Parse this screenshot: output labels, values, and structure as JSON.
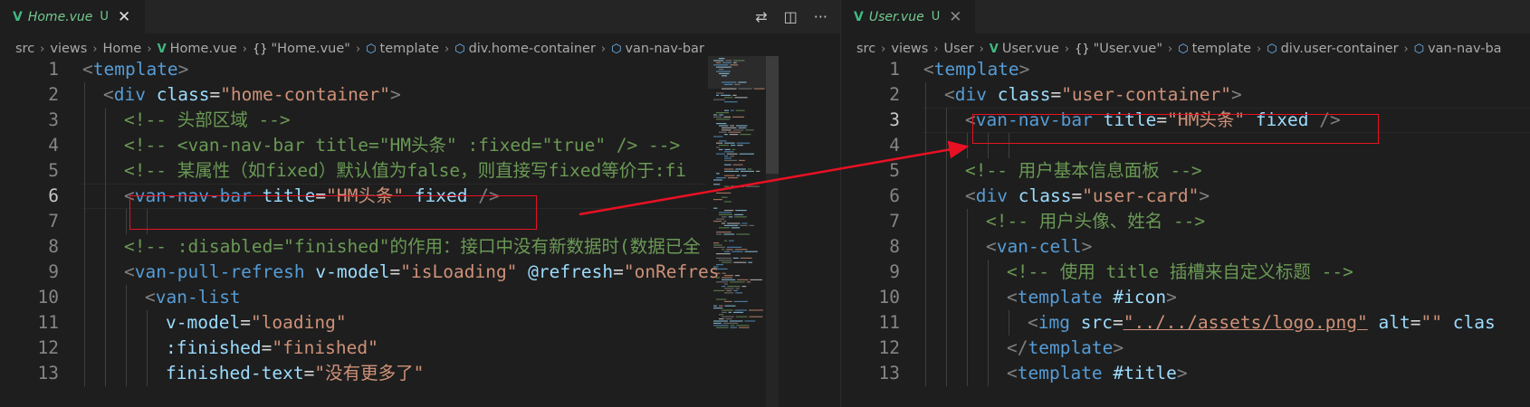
{
  "left": {
    "tab": {
      "icon": "vue-file-icon",
      "vicon": "V",
      "title": "Home.vue",
      "badge": "U",
      "close": "✕"
    },
    "actions": [
      {
        "name": "compare-changes-icon",
        "glyph": "⇄"
      },
      {
        "name": "split-editor-icon",
        "glyph": "◫"
      },
      {
        "name": "more-actions-icon",
        "glyph": "···"
      }
    ],
    "breadcrumb": [
      {
        "label": "src",
        "icon": ""
      },
      {
        "label": "views",
        "icon": ""
      },
      {
        "label": "Home",
        "icon": ""
      },
      {
        "label": "Home.vue",
        "icon": "vue-icon"
      },
      {
        "label": "\"Home.vue\"",
        "icon": "braces-icon"
      },
      {
        "label": "template",
        "icon": "cube-icon"
      },
      {
        "label": "div.home-container",
        "icon": "cube-icon"
      },
      {
        "label": "van-nav-bar",
        "icon": "cube-icon"
      }
    ],
    "current_line": 6,
    "lines": [
      {
        "n": "1",
        "indent": 0,
        "tokens": [
          [
            "punc",
            "<"
          ],
          [
            "tag",
            "template"
          ],
          [
            "punc",
            ">"
          ]
        ]
      },
      {
        "n": "2",
        "indent": 1,
        "tokens": [
          [
            "punc",
            "<"
          ],
          [
            "tag",
            "div"
          ],
          [
            "text",
            " "
          ],
          [
            "attr",
            "class"
          ],
          [
            "text",
            "="
          ],
          [
            "str",
            "\"home-container\""
          ],
          [
            "punc",
            ">"
          ]
        ]
      },
      {
        "n": "3",
        "indent": 2,
        "tokens": [
          [
            "com",
            "<!-- 头部区域 -->"
          ]
        ]
      },
      {
        "n": "4",
        "indent": 2,
        "tokens": [
          [
            "com",
            "<!-- <van-nav-bar title=\"HM头条\" :fixed=\"true\" /> -->"
          ]
        ]
      },
      {
        "n": "5",
        "indent": 2,
        "tokens": [
          [
            "com",
            "<!-- 某属性（如fixed）默认值为false，则直接写fixed等价于:fi"
          ]
        ]
      },
      {
        "n": "6",
        "indent": 2,
        "tokens": [
          [
            "punc",
            "<"
          ],
          [
            "tag",
            "van-nav-bar"
          ],
          [
            "text",
            " "
          ],
          [
            "attr",
            "title"
          ],
          [
            "text",
            "="
          ],
          [
            "str",
            "\"HM头条\""
          ],
          [
            "text",
            " "
          ],
          [
            "attr",
            "fixed"
          ],
          [
            "text",
            " "
          ],
          [
            "punc",
            "/>"
          ]
        ]
      },
      {
        "n": "7",
        "indent": 2,
        "tokens": []
      },
      {
        "n": "8",
        "indent": 2,
        "tokens": [
          [
            "com",
            "<!-- :disabled=\"finished\"的作用：接口中没有新数据时(数据已全"
          ]
        ]
      },
      {
        "n": "9",
        "indent": 2,
        "tokens": [
          [
            "punc",
            "<"
          ],
          [
            "tag",
            "van-pull-refresh"
          ],
          [
            "text",
            " "
          ],
          [
            "attr",
            "v-model"
          ],
          [
            "text",
            "="
          ],
          [
            "str",
            "\"isLoading\""
          ],
          [
            "text",
            " "
          ],
          [
            "attr",
            "@refresh"
          ],
          [
            "text",
            "="
          ],
          [
            "str",
            "\"onRefres"
          ]
        ]
      },
      {
        "n": "10",
        "indent": 3,
        "tokens": [
          [
            "punc",
            "<"
          ],
          [
            "tag",
            "van-list"
          ]
        ]
      },
      {
        "n": "11",
        "indent": 4,
        "tokens": [
          [
            "attr",
            "v-model"
          ],
          [
            "text",
            "="
          ],
          [
            "str",
            "\"loading\""
          ]
        ]
      },
      {
        "n": "12",
        "indent": 4,
        "tokens": [
          [
            "attr",
            ":finished"
          ],
          [
            "text",
            "="
          ],
          [
            "str",
            "\"finished\""
          ]
        ]
      },
      {
        "n": "13",
        "indent": 4,
        "tokens": [
          [
            "attr",
            "finished-text"
          ],
          [
            "text",
            "="
          ],
          [
            "str",
            "\"没有更多了\""
          ]
        ]
      }
    ]
  },
  "right": {
    "tab": {
      "icon": "vue-file-icon",
      "vicon": "V",
      "title": "User.vue",
      "badge": "U",
      "close": "✕"
    },
    "breadcrumb": [
      {
        "label": "src",
        "icon": ""
      },
      {
        "label": "views",
        "icon": ""
      },
      {
        "label": "User",
        "icon": ""
      },
      {
        "label": "User.vue",
        "icon": "vue-icon"
      },
      {
        "label": "\"User.vue\"",
        "icon": "braces-icon"
      },
      {
        "label": "template",
        "icon": "cube-icon"
      },
      {
        "label": "div.user-container",
        "icon": "cube-icon"
      },
      {
        "label": "van-nav-ba",
        "icon": "cube-icon"
      }
    ],
    "current_line": 3,
    "lines": [
      {
        "n": "1",
        "indent": 0,
        "tokens": [
          [
            "punc",
            "<"
          ],
          [
            "tag",
            "template"
          ],
          [
            "punc",
            ">"
          ]
        ]
      },
      {
        "n": "2",
        "indent": 1,
        "tokens": [
          [
            "punc",
            "<"
          ],
          [
            "tag",
            "div"
          ],
          [
            "text",
            " "
          ],
          [
            "attr",
            "class"
          ],
          [
            "text",
            "="
          ],
          [
            "str",
            "\"user-container\""
          ],
          [
            "punc",
            ">"
          ]
        ]
      },
      {
        "n": "3",
        "indent": 2,
        "tokens": [
          [
            "punc",
            "<"
          ],
          [
            "tag",
            "van-nav-bar"
          ],
          [
            "text",
            " "
          ],
          [
            "attr",
            "title"
          ],
          [
            "text",
            "="
          ],
          [
            "str",
            "\"HM头条\""
          ],
          [
            "text",
            " "
          ],
          [
            "attr",
            "fixed"
          ],
          [
            "text",
            " "
          ],
          [
            "punc",
            "/>"
          ]
        ]
      },
      {
        "n": "4",
        "indent": 2,
        "tokens": []
      },
      {
        "n": "5",
        "indent": 2,
        "tokens": [
          [
            "com",
            "<!-- 用户基本信息面板 -->"
          ]
        ]
      },
      {
        "n": "6",
        "indent": 2,
        "tokens": [
          [
            "punc",
            "<"
          ],
          [
            "tag",
            "div"
          ],
          [
            "text",
            " "
          ],
          [
            "attr",
            "class"
          ],
          [
            "text",
            "="
          ],
          [
            "str",
            "\"user-card\""
          ],
          [
            "punc",
            ">"
          ]
        ]
      },
      {
        "n": "7",
        "indent": 3,
        "tokens": [
          [
            "com",
            "<!-- 用户头像、姓名 -->"
          ]
        ]
      },
      {
        "n": "8",
        "indent": 3,
        "tokens": [
          [
            "punc",
            "<"
          ],
          [
            "tag",
            "van-cell"
          ],
          [
            "punc",
            ">"
          ]
        ]
      },
      {
        "n": "9",
        "indent": 4,
        "tokens": [
          [
            "com",
            "<!-- 使用 title 插槽来自定义标题 -->"
          ]
        ]
      },
      {
        "n": "10",
        "indent": 4,
        "tokens": [
          [
            "punc",
            "<"
          ],
          [
            "tag",
            "template"
          ],
          [
            "text",
            " "
          ],
          [
            "attr",
            "#icon"
          ],
          [
            "punc",
            ">"
          ]
        ]
      },
      {
        "n": "11",
        "indent": 5,
        "tokens": [
          [
            "punc",
            "<"
          ],
          [
            "tag",
            "img"
          ],
          [
            "text",
            " "
          ],
          [
            "attr",
            "src"
          ],
          [
            "text",
            "="
          ],
          [
            "link",
            "\"../../assets/logo.png\""
          ],
          [
            "text",
            " "
          ],
          [
            "attr",
            "alt"
          ],
          [
            "text",
            "="
          ],
          [
            "str",
            "\"\""
          ],
          [
            "text",
            " "
          ],
          [
            "attr",
            "clas"
          ]
        ]
      },
      {
        "n": "12",
        "indent": 4,
        "tokens": [
          [
            "punc",
            "</"
          ],
          [
            "tag",
            "template"
          ],
          [
            "punc",
            ">"
          ]
        ]
      },
      {
        "n": "13",
        "indent": 4,
        "tokens": [
          [
            "punc",
            "<"
          ],
          [
            "tag",
            "template"
          ],
          [
            "text",
            " "
          ],
          [
            "attr",
            "#title"
          ],
          [
            "punc",
            ">"
          ]
        ]
      }
    ]
  },
  "colors": {
    "background": "#1e1e1e",
    "highlight_box": "#e81123",
    "arrow": "#e81123",
    "untracked_tab": "#73c991",
    "vue_icon": "#41b883"
  }
}
